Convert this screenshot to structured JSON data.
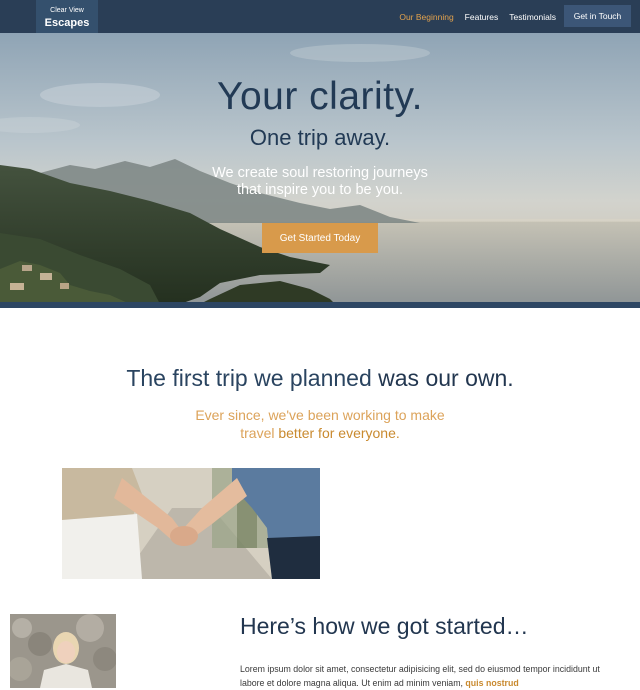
{
  "nav": {
    "logo_line1": "Clear View",
    "logo_line2": "Escapes",
    "links": [
      "Our Beginning",
      "Features",
      "Testimonials"
    ],
    "cta": "Get in Touch"
  },
  "hero": {
    "title": "Your clarity.",
    "subtitle": "One trip away.",
    "description": "We create soul restoring journeys that inspire you to be you.",
    "button": "Get Started Today"
  },
  "story": {
    "title_light": "The first trip we planned ",
    "title_bold": "was our own.",
    "sub_plain": "Ever since, we've been working to make travel ",
    "sub_accent": "better for everyone."
  },
  "howto": {
    "title": "Here’s how we got started…",
    "lorem_plain": "Lorem ipsum dolor sit amet, consectetur adipisicing elit, sed do eiusmod tempor incididunt ut labore et dolore magna aliqua. Ut enim ad minim veniam, ",
    "lorem_accent": "quis nostrud"
  },
  "colors": {
    "nav_bg": "#2a3e56",
    "accent": "#d89a4b",
    "heading": "#22364f"
  }
}
